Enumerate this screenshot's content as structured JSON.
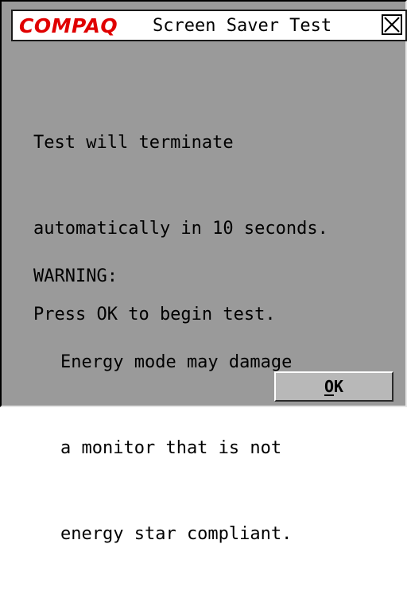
{
  "window": {
    "brand": "COMPAQ",
    "title": "Screen Saver Test",
    "close_icon": "close-x-icon"
  },
  "message": {
    "line1": "Test will terminate",
    "line2": "automatically in 10 seconds.",
    "line3": "Press OK to begin test."
  },
  "warning": {
    "heading": "WARNING:",
    "line1": "Energy mode may damage",
    "line2": "a monitor that is not",
    "line3": "energy star compliant."
  },
  "buttons": {
    "ok_mnemonic": "O",
    "ok_rest": "K"
  },
  "colors": {
    "window_bg": "#9a9a9a",
    "brand_red": "#e00000",
    "titlebar_bg": "#ffffff",
    "button_bg": "#b8b8b8"
  }
}
